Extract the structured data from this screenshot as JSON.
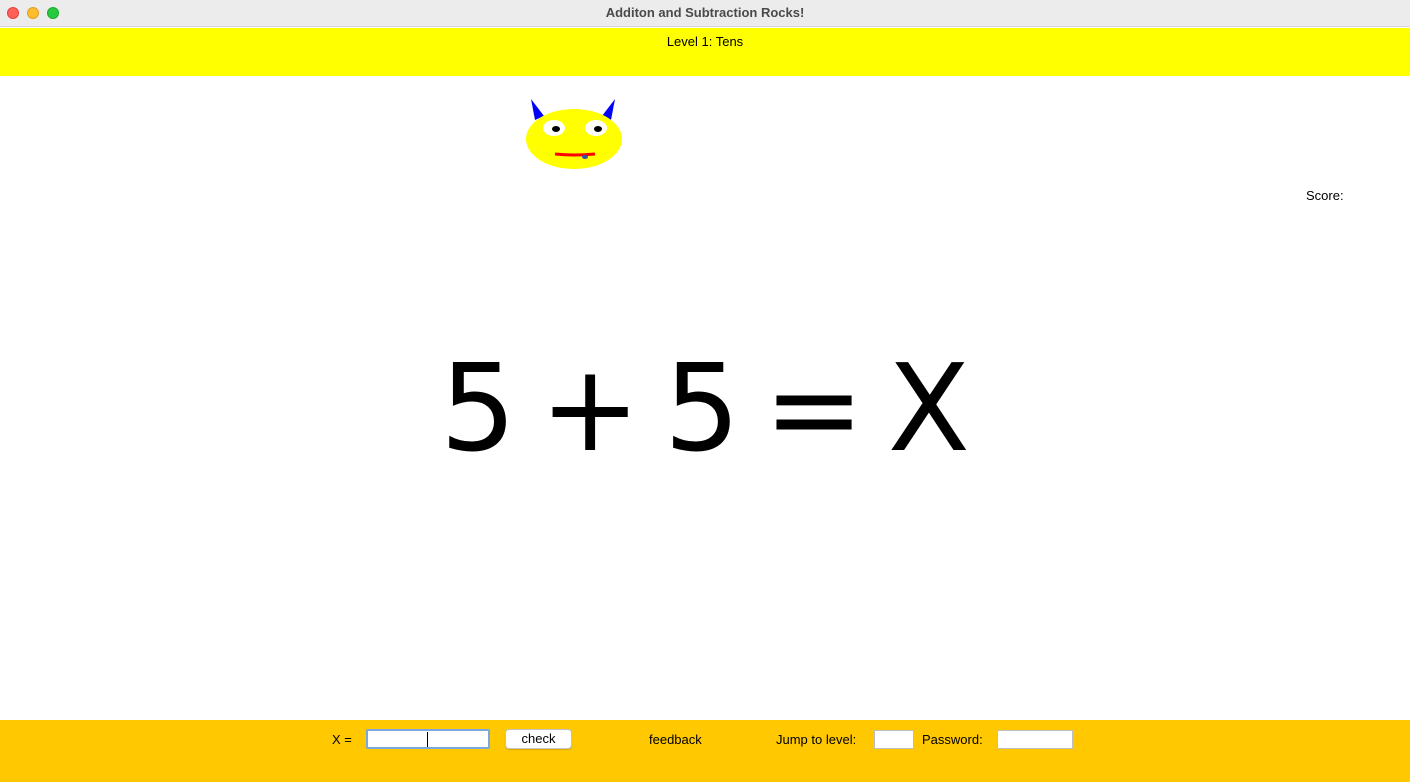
{
  "window": {
    "title": "Additon and Subtraction Rocks!"
  },
  "level_bar": {
    "text": "Level 1: Tens",
    "color": "#ffff00"
  },
  "score": {
    "label": "Score:",
    "value": ""
  },
  "equation": {
    "operand_a": "5",
    "operator": "+",
    "operand_b": "5",
    "equals": "=",
    "unknown": "X"
  },
  "controls": {
    "bar_color": "#ffc800",
    "answer_label": "X =",
    "answer_value": "",
    "check_label": "check",
    "feedback_text": "feedback",
    "jump_label": "Jump to level:",
    "jump_value": "",
    "password_label": "Password:",
    "password_value": ""
  },
  "icons": {
    "monster": "horned-monster-face-icon"
  }
}
